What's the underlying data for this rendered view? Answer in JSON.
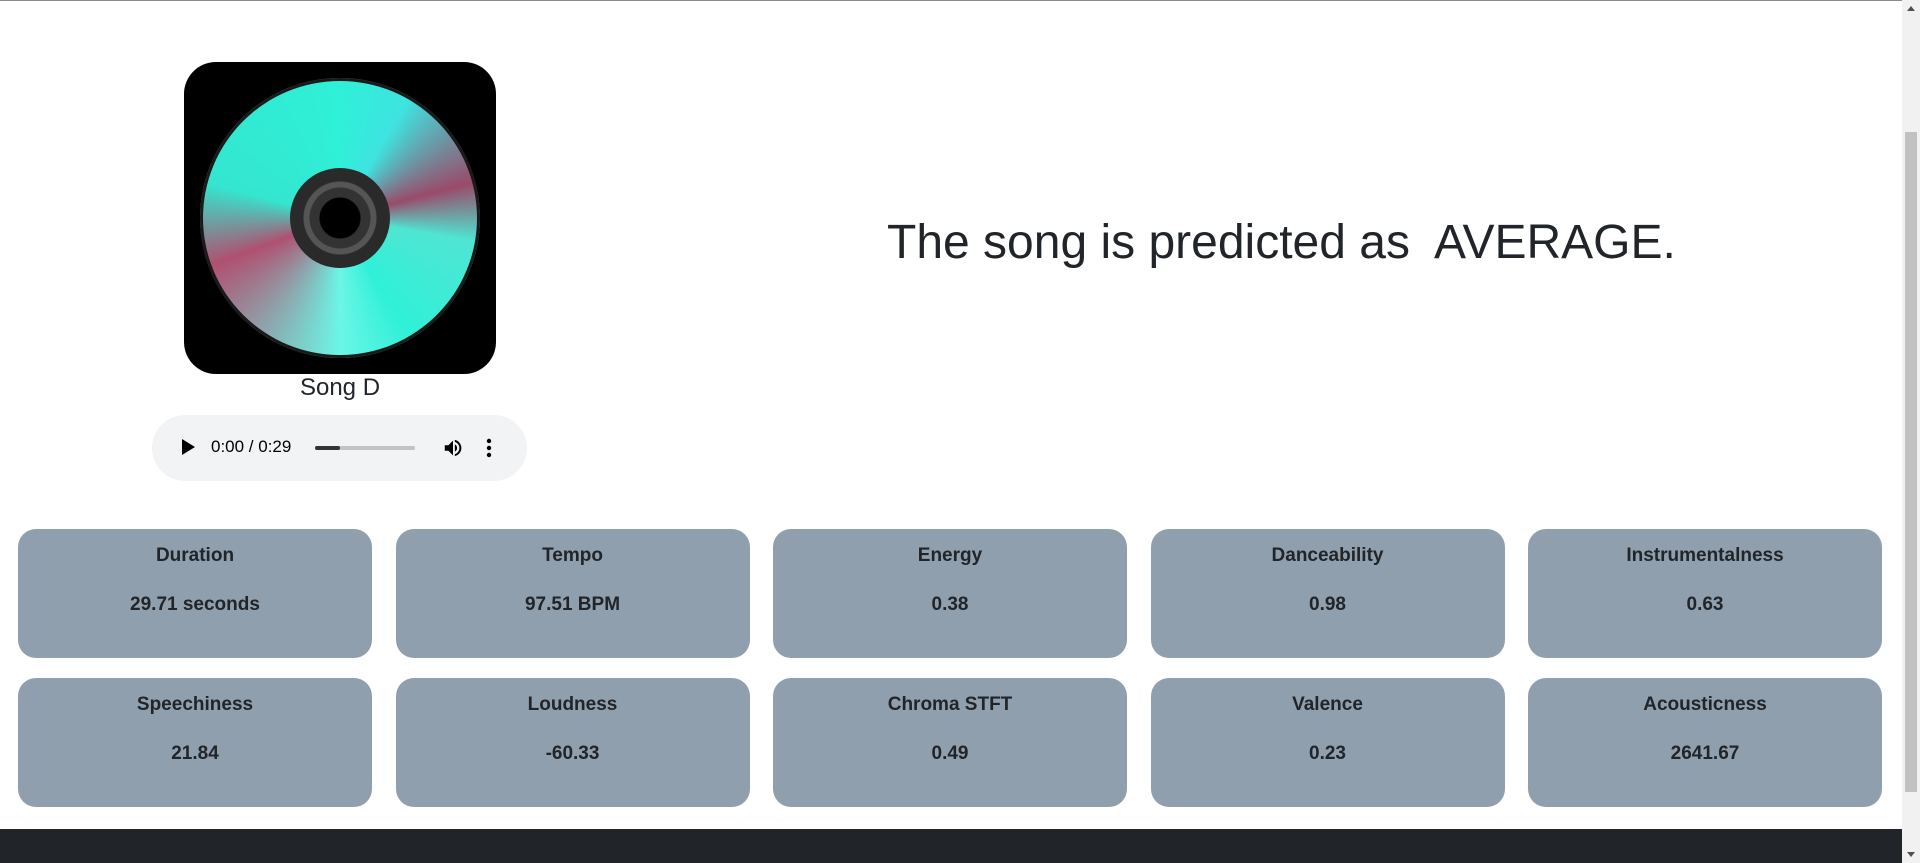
{
  "song": {
    "title": "Song D"
  },
  "player": {
    "time_display": "0:00 / 0:29",
    "progress_fraction": 0.25
  },
  "prediction": {
    "text": "The song is predicted as  AVERAGE."
  },
  "features": [
    {
      "label": "Duration",
      "value": "29.71 seconds"
    },
    {
      "label": "Tempo",
      "value": "97.51 BPM"
    },
    {
      "label": "Energy",
      "value": "0.38"
    },
    {
      "label": "Danceability",
      "value": "0.98"
    },
    {
      "label": "Instrumentalness",
      "value": "0.63"
    },
    {
      "label": "Speechiness",
      "value": "21.84"
    },
    {
      "label": "Loudness",
      "value": "-60.33"
    },
    {
      "label": "Chroma STFT",
      "value": "0.49"
    },
    {
      "label": "Valence",
      "value": "0.23"
    },
    {
      "label": "Acousticness",
      "value": "2641.67"
    }
  ],
  "colors": {
    "card_background": "#909fae",
    "footer_background": "#212529",
    "player_background": "#f1f3f4"
  }
}
